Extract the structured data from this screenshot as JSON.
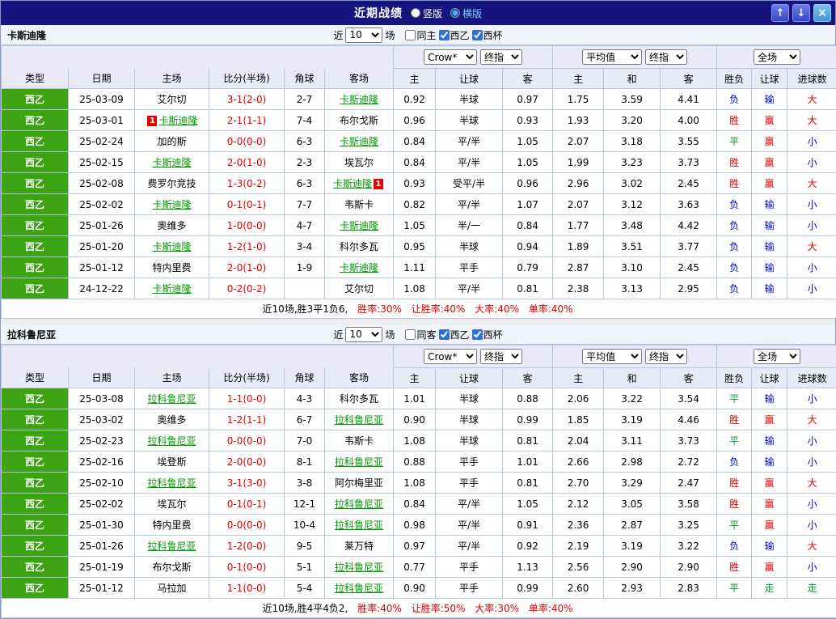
{
  "title_bar": {
    "title": "近期战绩",
    "vertical_label": "竖版",
    "horizontal_label": "横版",
    "vertical_selected": false,
    "horizontal_selected": true,
    "up_icon": "↑",
    "down_icon": "↓",
    "close_icon": "×"
  },
  "colors": {
    "win": "#e10000",
    "loss": "#0000cc",
    "draw": "#009933",
    "score": "#e10000",
    "team_focus": "#009900",
    "league_bg": "#3da313",
    "card_bg": "#e60000"
  },
  "sections": [
    {
      "team": "卡斯迪隆",
      "filters": {
        "near": "近",
        "count": "10",
        "games": "场",
        "same_venue_label": "同主",
        "same_venue_checked": false,
        "league_label": "西乙",
        "league_checked": true,
        "cup_label": "西杯",
        "cup_checked": true
      },
      "header_selects": {
        "odds_company": "Crow*",
        "odds_final": "终指",
        "average": "平均值",
        "average_final": "终指",
        "scope": "全场"
      },
      "columns": [
        "类型",
        "日期",
        "主场",
        "比分(半场)",
        "角球",
        "客场",
        "主",
        "让球",
        "客",
        "主",
        "和",
        "客",
        "胜负",
        "让球",
        "进球数"
      ],
      "rows": [
        {
          "league": "西乙",
          "date": "25-03-09",
          "home": "艾尔切",
          "home_focus": false,
          "home_card": "",
          "score": "3-1(2-0)",
          "corners": "2-7",
          "away": "卡斯迪隆",
          "away_focus": true,
          "away_card": "",
          "odds": [
            "0.92",
            "半球",
            "0.97"
          ],
          "avg": [
            "1.75",
            "3.59",
            "4.41"
          ],
          "results": [
            "负",
            "输",
            "大"
          ]
        },
        {
          "league": "西乙",
          "date": "25-03-01",
          "home": "卡斯迪隆",
          "home_focus": true,
          "home_card": "1",
          "score": "2-1(1-1)",
          "corners": "7-4",
          "away": "布尔戈斯",
          "away_focus": false,
          "away_card": "",
          "odds": [
            "0.96",
            "半球",
            "0.93"
          ],
          "avg": [
            "1.93",
            "3.20",
            "4.00"
          ],
          "results": [
            "胜",
            "赢",
            "大"
          ]
        },
        {
          "league": "西乙",
          "date": "25-02-24",
          "home": "加的斯",
          "home_focus": false,
          "home_card": "",
          "score": "0-0(0-0)",
          "corners": "6-3",
          "away": "卡斯迪隆",
          "away_focus": true,
          "away_card": "",
          "odds": [
            "0.84",
            "平/半",
            "1.05"
          ],
          "avg": [
            "2.07",
            "3.18",
            "3.55"
          ],
          "results": [
            "平",
            "赢",
            "小"
          ]
        },
        {
          "league": "西乙",
          "date": "25-02-15",
          "home": "卡斯迪隆",
          "home_focus": true,
          "home_card": "",
          "score": "2-0(1-0)",
          "corners": "2-3",
          "away": "埃瓦尔",
          "away_focus": false,
          "away_card": "",
          "odds": [
            "0.84",
            "平/半",
            "1.05"
          ],
          "avg": [
            "1.99",
            "3.23",
            "3.73"
          ],
          "results": [
            "胜",
            "赢",
            "小"
          ]
        },
        {
          "league": "西乙",
          "date": "25-02-08",
          "home": "费罗尔竞技",
          "home_focus": false,
          "home_card": "",
          "score": "1-3(0-2)",
          "corners": "6-3",
          "away": "卡斯迪隆",
          "away_focus": true,
          "away_card": "1",
          "odds": [
            "0.93",
            "受平/半",
            "0.96"
          ],
          "avg": [
            "2.96",
            "3.02",
            "2.45"
          ],
          "results": [
            "胜",
            "赢",
            "大"
          ]
        },
        {
          "league": "西乙",
          "date": "25-02-02",
          "home": "卡斯迪隆",
          "home_focus": true,
          "home_card": "",
          "score": "0-1(0-1)",
          "corners": "7-7",
          "away": "韦斯卡",
          "away_focus": false,
          "away_card": "",
          "odds": [
            "0.82",
            "平/半",
            "1.07"
          ],
          "avg": [
            "2.07",
            "3.12",
            "3.63"
          ],
          "results": [
            "负",
            "输",
            "小"
          ]
        },
        {
          "league": "西乙",
          "date": "25-01-26",
          "home": "奥维多",
          "home_focus": false,
          "home_card": "",
          "score": "1-0(0-0)",
          "corners": "4-7",
          "away": "卡斯迪隆",
          "away_focus": true,
          "away_card": "",
          "odds": [
            "1.05",
            "半/一",
            "0.84"
          ],
          "avg": [
            "1.77",
            "3.48",
            "4.42"
          ],
          "results": [
            "负",
            "输",
            "小"
          ]
        },
        {
          "league": "西乙",
          "date": "25-01-20",
          "home": "卡斯迪隆",
          "home_focus": true,
          "home_card": "",
          "score": "1-2(1-0)",
          "corners": "3-4",
          "away": "科尔多瓦",
          "away_focus": false,
          "away_card": "",
          "odds": [
            "0.95",
            "半球",
            "0.94"
          ],
          "avg": [
            "1.89",
            "3.51",
            "3.77"
          ],
          "results": [
            "负",
            "输",
            "大"
          ]
        },
        {
          "league": "西乙",
          "date": "25-01-12",
          "home": "特内里费",
          "home_focus": false,
          "home_card": "",
          "score": "2-0(1-0)",
          "corners": "1-9",
          "away": "卡斯迪隆",
          "away_focus": true,
          "away_card": "",
          "odds": [
            "1.11",
            "平手",
            "0.79"
          ],
          "avg": [
            "2.87",
            "3.10",
            "2.45"
          ],
          "results": [
            "负",
            "输",
            "小"
          ]
        },
        {
          "league": "西乙",
          "date": "24-12-22",
          "home": "卡斯迪隆",
          "home_focus": true,
          "home_card": "",
          "score": "0-2(0-2)",
          "corners": "",
          "away": "艾尔切",
          "away_focus": false,
          "away_card": "",
          "odds": [
            "1.08",
            "平/半",
            "0.81"
          ],
          "avg": [
            "2.38",
            "3.13",
            "2.95"
          ],
          "results": [
            "负",
            "输",
            "小"
          ]
        }
      ],
      "summary": {
        "prefix": "近10场,胜3平1负6,",
        "stats": [
          "胜率:30%",
          "让胜率:40%",
          "大率:40%",
          "单率:40%"
        ]
      }
    },
    {
      "team": "拉科鲁尼亚",
      "filters": {
        "near": "近",
        "count": "10",
        "games": "场",
        "same_venue_label": "同客",
        "same_venue_checked": false,
        "league_label": "西乙",
        "league_checked": true,
        "cup_label": "西杯",
        "cup_checked": true
      },
      "header_selects": {
        "odds_company": "Crow*",
        "odds_final": "终指",
        "average": "平均值",
        "average_final": "终指",
        "scope": "全场"
      },
      "columns": [
        "类型",
        "日期",
        "主场",
        "比分(半场)",
        "角球",
        "客场",
        "主",
        "让球",
        "客",
        "主",
        "和",
        "客",
        "胜负",
        "让球",
        "进球数"
      ],
      "rows": [
        {
          "league": "西乙",
          "date": "25-03-08",
          "home": "拉科鲁尼亚",
          "home_focus": true,
          "home_card": "",
          "score": "1-1(0-0)",
          "corners": "4-3",
          "away": "科尔多瓦",
          "away_focus": false,
          "away_card": "",
          "odds": [
            "1.01",
            "半球",
            "0.88"
          ],
          "avg": [
            "2.06",
            "3.22",
            "3.54"
          ],
          "results": [
            "平",
            "输",
            "小"
          ]
        },
        {
          "league": "西乙",
          "date": "25-03-02",
          "home": "奥维多",
          "home_focus": false,
          "home_card": "",
          "score": "1-2(1-1)",
          "corners": "6-7",
          "away": "拉科鲁尼亚",
          "away_focus": true,
          "away_card": "",
          "odds": [
            "0.90",
            "半球",
            "0.99"
          ],
          "avg": [
            "1.85",
            "3.19",
            "4.46"
          ],
          "results": [
            "胜",
            "赢",
            "大"
          ]
        },
        {
          "league": "西乙",
          "date": "25-02-23",
          "home": "拉科鲁尼亚",
          "home_focus": true,
          "home_card": "",
          "score": "0-0(0-0)",
          "corners": "7-0",
          "away": "韦斯卡",
          "away_focus": false,
          "away_card": "",
          "odds": [
            "1.08",
            "半球",
            "0.81"
          ],
          "avg": [
            "2.04",
            "3.11",
            "3.73"
          ],
          "results": [
            "平",
            "输",
            "小"
          ]
        },
        {
          "league": "西乙",
          "date": "25-02-16",
          "home": "埃登斯",
          "home_focus": false,
          "home_card": "",
          "score": "2-0(0-0)",
          "corners": "8-1",
          "away": "拉科鲁尼亚",
          "away_focus": true,
          "away_card": "",
          "odds": [
            "0.88",
            "平手",
            "1.01"
          ],
          "avg": [
            "2.66",
            "2.98",
            "2.72"
          ],
          "results": [
            "负",
            "输",
            "小"
          ]
        },
        {
          "league": "西乙",
          "date": "25-02-10",
          "home": "拉科鲁尼亚",
          "home_focus": true,
          "home_card": "",
          "score": "3-1(3-0)",
          "corners": "3-8",
          "away": "阿尔梅里亚",
          "away_focus": false,
          "away_card": "",
          "odds": [
            "1.08",
            "平手",
            "0.81"
          ],
          "avg": [
            "2.70",
            "3.29",
            "2.47"
          ],
          "results": [
            "胜",
            "赢",
            "大"
          ]
        },
        {
          "league": "西乙",
          "date": "25-02-02",
          "home": "埃瓦尔",
          "home_focus": false,
          "home_card": "",
          "score": "0-1(0-1)",
          "corners": "12-1",
          "away": "拉科鲁尼亚",
          "away_focus": true,
          "away_card": "",
          "odds": [
            "0.84",
            "平/半",
            "1.05"
          ],
          "avg": [
            "2.12",
            "3.05",
            "3.58"
          ],
          "results": [
            "胜",
            "赢",
            "小"
          ]
        },
        {
          "league": "西乙",
          "date": "25-01-30",
          "home": "特内里费",
          "home_focus": false,
          "home_card": "",
          "score": "0-0(0-0)",
          "corners": "10-4",
          "away": "拉科鲁尼亚",
          "away_focus": true,
          "away_card": "",
          "odds": [
            "0.98",
            "平/半",
            "0.91"
          ],
          "avg": [
            "2.36",
            "2.87",
            "3.25"
          ],
          "results": [
            "平",
            "赢",
            "小"
          ]
        },
        {
          "league": "西乙",
          "date": "25-01-26",
          "home": "拉科鲁尼亚",
          "home_focus": true,
          "home_card": "",
          "score": "1-2(0-0)",
          "corners": "9-5",
          "away": "莱万特",
          "away_focus": false,
          "away_card": "",
          "odds": [
            "0.97",
            "平/半",
            "0.92"
          ],
          "avg": [
            "2.19",
            "3.19",
            "3.22"
          ],
          "results": [
            "负",
            "输",
            "大"
          ]
        },
        {
          "league": "西乙",
          "date": "25-01-19",
          "home": "布尔戈斯",
          "home_focus": false,
          "home_card": "",
          "score": "0-1(0-0)",
          "corners": "5-1",
          "away": "拉科鲁尼亚",
          "away_focus": true,
          "away_card": "",
          "odds": [
            "0.77",
            "平手",
            "1.13"
          ],
          "avg": [
            "2.56",
            "2.90",
            "2.90"
          ],
          "results": [
            "胜",
            "赢",
            "小"
          ]
        },
        {
          "league": "西乙",
          "date": "25-01-12",
          "home": "马拉加",
          "home_focus": false,
          "home_card": "",
          "score": "1-1(0-0)",
          "corners": "5-4",
          "away": "拉科鲁尼亚",
          "away_focus": true,
          "away_card": "",
          "odds": [
            "0.90",
            "平手",
            "0.99"
          ],
          "avg": [
            "2.60",
            "2.93",
            "2.83"
          ],
          "results": [
            "平",
            "走",
            "走"
          ]
        }
      ],
      "summary": {
        "prefix": "近10场,胜4平4负2,",
        "stats": [
          "胜率:40%",
          "让胜率:50%",
          "大率:30%",
          "单率:40%"
        ]
      }
    }
  ]
}
